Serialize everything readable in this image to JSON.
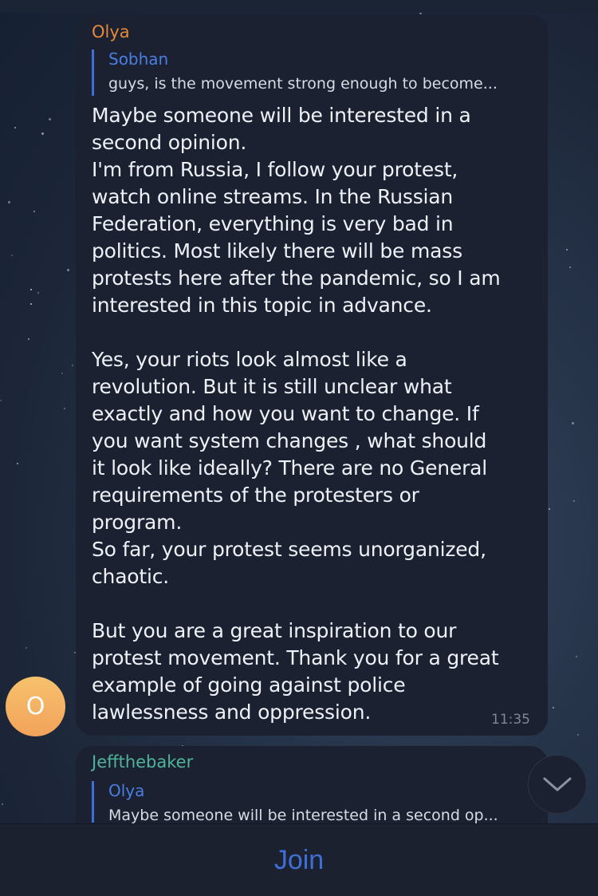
{
  "messages": [
    {
      "sender": "Olya",
      "reply": {
        "name": "Sobhan",
        "text": "guys, is the movement strong enough to become..."
      },
      "text": "Maybe someone will be interested in a\nsecond opinion.\nI'm from Russia, I follow your protest,\nwatch online streams. In the Russian\nFederation, everything is very bad in\npolitics. Most likely there will be mass\nprotests here after the pandemic, so I am\ninterested in this topic in advance.\n\nYes, your riots look almost like a\nrevolution. But it is still unclear what\nexactly and how you want to change. If\nyou want system changes , what should\nit look like ideally? There are no General\nrequirements of the protesters or\nprogram.\nSo far, your protest seems unorganized,\nchaotic.\n\nBut you are a great inspiration to our\nprotest movement. Thank you for a great\nexample of going against police\nlawlessness and oppression.",
      "time": "11:35",
      "avatar_letter": "O"
    },
    {
      "sender": "Jeffthebaker",
      "reply": {
        "name": "Olya",
        "text": "Maybe someone will be interested in a second op..."
      }
    }
  ],
  "scroll_icon": "chevron-down-icon",
  "join_label": "Join",
  "colors": {
    "accent": "#3d6fd6",
    "sender_olya": "#e58a3a",
    "sender_jeff": "#4fb39a",
    "bubble": "#1b2130"
  }
}
